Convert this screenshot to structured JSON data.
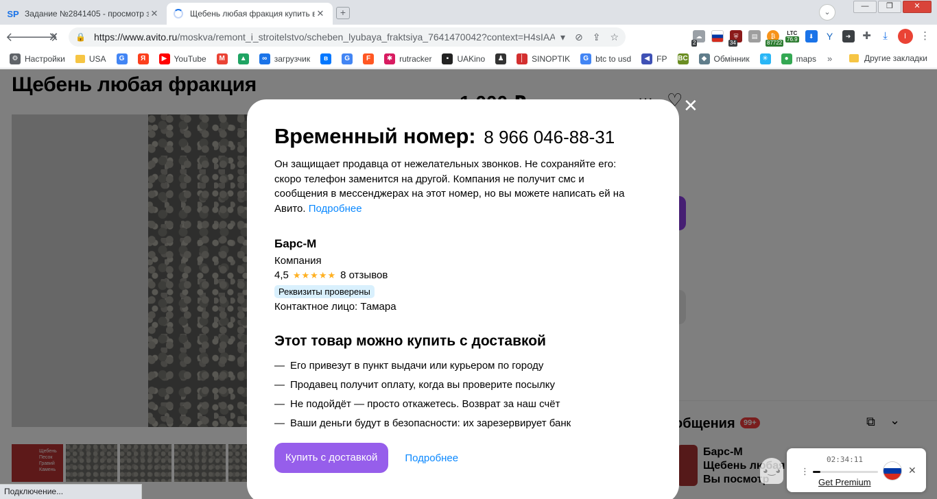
{
  "browser": {
    "tabs": [
      {
        "favicon_text": "SP",
        "title": "Задание №2841405 - просмотр з",
        "close": "✕"
      },
      {
        "title": "Щебень любая фракция купить в",
        "close": "✕"
      }
    ],
    "new_tab_icon": "+",
    "profile_icon": "chevron-down-icon",
    "window_controls": {
      "minimize": "—",
      "maximize": "❐",
      "close": "✕"
    },
    "nav": {
      "back": "🡐",
      "forward": "🡒",
      "stop": "✕"
    },
    "omnibox": {
      "host": "https://www.avito.ru",
      "path": "/moskva/remont_i_stroitelstvo/scheben_lyubaya_fraktsiya_7641470042?context=H4sIAAAAAAAA_wE_...",
      "dropdown": "▾"
    },
    "extensions": {
      "cloud_badge": "2",
      "shield_badge": "34",
      "bitcoin_badge": "87722",
      "ltc_label": "LTC",
      "ltc_value": "76.9",
      "profile_initial": "I"
    },
    "bookmarks": [
      {
        "label": "Настройки",
        "icon": "gear-icon",
        "color": "#5f6368",
        "glyph": "⚙"
      },
      {
        "label": "USA",
        "icon": "folder-icon"
      },
      {
        "label": "",
        "icon": "google-icon",
        "color": "#4285f4",
        "glyph": "G"
      },
      {
        "label": "",
        "icon": "yandex-icon",
        "color": "#fc3f1d",
        "glyph": "Я"
      },
      {
        "label": "YouTube",
        "icon": "youtube-icon",
        "color": "#ff0000",
        "glyph": "▶"
      },
      {
        "label": "",
        "icon": "gmail-icon",
        "color": "#ea4335",
        "glyph": "M"
      },
      {
        "label": "",
        "icon": "drive-icon",
        "color": "#1fa463",
        "glyph": "▲"
      },
      {
        "label": "загрузчик",
        "icon": "loop-icon",
        "color": "#1a73e8",
        "glyph": "∞"
      },
      {
        "label": "",
        "icon": "vk-icon",
        "color": "#0077ff",
        "glyph": "в"
      },
      {
        "label": "",
        "icon": "translate-icon",
        "color": "#4285f4",
        "glyph": "G"
      },
      {
        "label": "",
        "icon": "f-icon",
        "color": "#ff5722",
        "glyph": "F"
      },
      {
        "label": "rutracker",
        "icon": "rutracker-icon",
        "color": "#d81b60",
        "glyph": "✱"
      },
      {
        "label": "UAKino",
        "icon": "uakino-icon",
        "color": "#222222",
        "glyph": "▪"
      },
      {
        "label": "",
        "icon": "chess-icon",
        "color": "#333333",
        "glyph": "♟"
      },
      {
        "label": "SINOPTIK",
        "icon": "thermometer-icon",
        "color": "#d32f2f",
        "glyph": "│"
      },
      {
        "label": "btc to usd",
        "icon": "google-icon",
        "color": "#4285f4",
        "glyph": "G"
      },
      {
        "label": "FP",
        "icon": "fp-icon",
        "color": "#3f51b5",
        "glyph": "◀"
      },
      {
        "label": "",
        "icon": "bc-icon",
        "color": "#6b8e23",
        "glyph": "BC"
      },
      {
        "label": "Обмінник",
        "icon": "exchange-icon",
        "color": "#607d8b",
        "glyph": "◆"
      },
      {
        "label": "",
        "icon": "snowflake-icon",
        "color": "#29b6f6",
        "glyph": "✳"
      },
      {
        "label": "maps",
        "icon": "maps-icon",
        "color": "#34a853",
        "glyph": "●"
      }
    ],
    "bookmarks_more": "»",
    "other_bookmarks": "Другие закладки"
  },
  "page": {
    "title": "Щебень любая фракция",
    "price": "1 000 ₽",
    "thumb_text": "Щебень\nПесок\nГравий\nКамень",
    "messages": {
      "title": "общения",
      "badge": "99+",
      "preview_lines": [
        "Барс-М",
        "Щебень любая фр",
        "Вы посмотр"
      ]
    }
  },
  "modal": {
    "phone_label": "Временный номер:",
    "phone_number": "8 966 046-88-31",
    "disclaimer": "Он защищает продавца от нежелательных звонков. Не сохраняйте его: скоро телефон заменится на другой. Компания не получит смс и сообщения в мессенджерах на этот номер, но вы можете написать ей на Авито.",
    "more_link": "Подробнее",
    "seller": {
      "name": "Барс-М",
      "type": "Компания",
      "rating": "4,5",
      "stars": "★★★★★",
      "reviews": "8 отзывов",
      "verified": "Реквизиты проверены",
      "contact": "Контактное лицо: Тамара"
    },
    "delivery_title": "Этот товар можно купить с доставкой",
    "features": [
      "Его привезут в пункт выдачи или курьером по городу",
      "Продавец получит оплату, когда вы проверите посылку",
      "Не подойдёт — просто откажетесь. Возврат за наш счёт",
      "Ваши деньги будут в безопасности: их зарезервирует банк"
    ],
    "buy_button": "Купить с доставкой",
    "details_link": "Подробнее",
    "close": "✕"
  },
  "status_bar": "Подключение...",
  "vpn": {
    "timer": "02:34:11",
    "progress": 0.12,
    "premium": "Get Premium",
    "menu": "⋮",
    "close": "✕",
    "flag_colors": [
      "#ffffff",
      "#0039a6",
      "#d52b1e"
    ]
  }
}
